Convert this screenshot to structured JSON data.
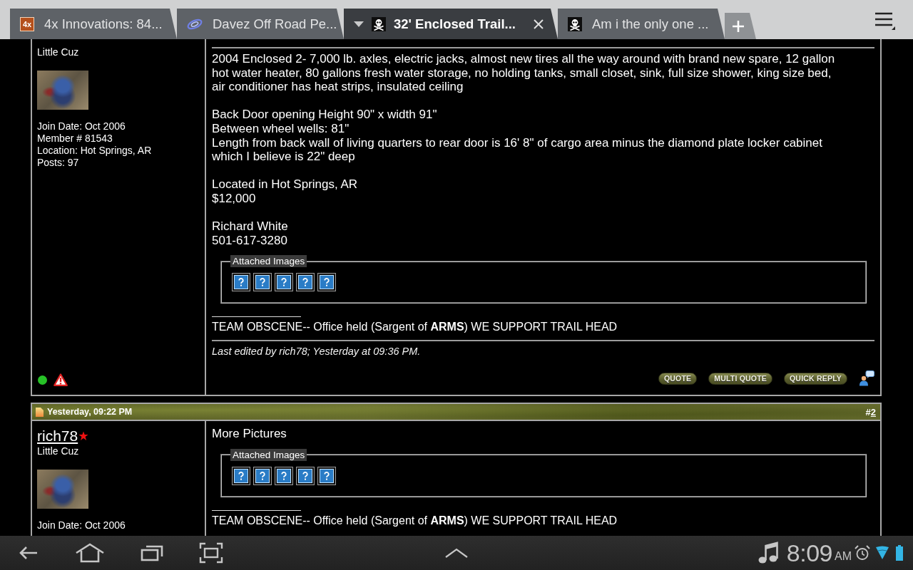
{
  "browser": {
    "tabs": [
      {
        "title": "4x Innovations: 84...",
        "selected": false,
        "favicon": {
          "kind": "text",
          "text": "4x"
        }
      },
      {
        "title": "Davez Off Road Pe...",
        "selected": false,
        "favicon": {
          "kind": "swirl"
        }
      },
      {
        "title": "32' Enclosed Trail...",
        "selected": true,
        "favicon": {
          "kind": "skull"
        }
      },
      {
        "title": "Am i the only one ...",
        "selected": false,
        "favicon": {
          "kind": "skull"
        }
      }
    ]
  },
  "posts": [
    {
      "author": {
        "rank": "Little Cuz",
        "stats": [
          "Join Date: Oct 2006",
          "Member # 81543",
          "Location: Hot Springs, AR",
          "Posts: 97"
        ]
      },
      "body": [
        [
          "2004 Enclosed 2- 7,000 lb. axles, electric jacks, almost new tires all the way around with brand new spare, 12 gallon hot water heater, 80 gallons fresh water storage, no holding tanks, small closet, sink, full size shower, king size bed, air conditioner has heat strips, insulated ceiling"
        ],
        [
          "Back Door opening Height 90\" x width 91\"",
          "Between wheel wells: 81\"",
          "Length from back wall of living quarters to rear door is 16' 8\" of cargo area minus the diamond plate locker cabinet which I believe is 22\" deep"
        ],
        [
          "Located in Hot Springs, AR",
          "$12,000"
        ],
        [
          "Richard White",
          "501-617-3280"
        ]
      ],
      "attachments": {
        "legend": "Attached Images",
        "images": [
          {
            "kind": "missing"
          },
          {
            "kind": "missing"
          },
          {
            "kind": "missing"
          },
          {
            "kind": "missing"
          },
          {
            "kind": "missing"
          }
        ]
      },
      "signature": "TEAM OBSCENE-- Office held (Sargent of **ARMS**) WE SUPPORT TRAIL HEAD",
      "edit_note": "Last edited by rich78; Yesterday at 09:36 PM.",
      "footer": {
        "online": true,
        "buttons": [
          "QUOTE",
          "MULTI QUOTE",
          "QUICK REPLY"
        ]
      }
    },
    {
      "header": {
        "date": "Yesterday, 09:22 PM",
        "number": {
          "prefix": "#",
          "value": "2"
        }
      },
      "author": {
        "username": "rich78",
        "rank": "Little Cuz",
        "stats": [
          "Join Date: Oct 2006"
        ]
      },
      "body": [
        [
          "More Pictures"
        ]
      ],
      "attachments": {
        "legend": "Attached Images",
        "images": [
          {
            "kind": "missing"
          },
          {
            "kind": "missing"
          },
          {
            "kind": "missing"
          },
          {
            "kind": "missing"
          },
          {
            "kind": "missing"
          }
        ]
      },
      "signature": "TEAM OBSCENE-- Office held (Sargent of **ARMS**) WE SUPPORT TRAIL HEAD"
    }
  ],
  "status_bar": {
    "time": "8:09",
    "meridiem": "AM"
  }
}
